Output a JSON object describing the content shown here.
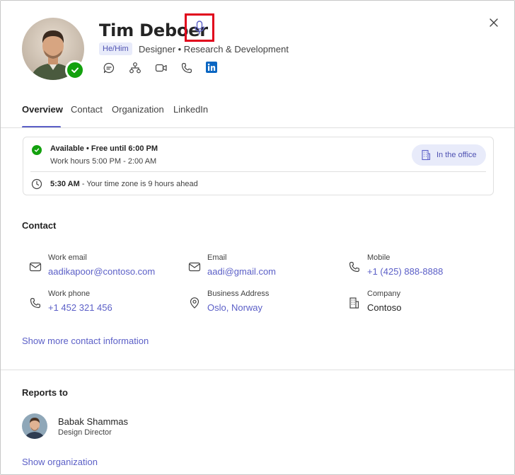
{
  "profile": {
    "name": "Tim Deboer",
    "pronouns": "He/Him",
    "subtitle": "Designer • Research & Development"
  },
  "tabs": [
    {
      "label": "Overview"
    },
    {
      "label": "Contact"
    },
    {
      "label": "Organization"
    },
    {
      "label": "LinkedIn"
    }
  ],
  "status": {
    "availability": "Available • Free until 6:00 PM",
    "work_hours": "Work hours 5:00 PM - 2:00 AM",
    "location_label": "In the office",
    "local_time": "5:30 AM",
    "timezone_note": " - Your time zone is 9 hours ahead"
  },
  "contact": {
    "title": "Contact",
    "items": [
      {
        "label": "Work email",
        "value": "aadikapoor@contoso.com",
        "icon": "mail-icon"
      },
      {
        "label": "Email",
        "value": "aadi@gmail.com",
        "icon": "mail-icon"
      },
      {
        "label": "Mobile",
        "value": "+1 (425) 888-8888",
        "icon": "phone-icon"
      },
      {
        "label": "Work phone",
        "value": "+1 452 321 456",
        "icon": "phone-icon"
      },
      {
        "label": "Business Address",
        "value": "Oslo, Norway",
        "icon": "location-icon"
      },
      {
        "label": "Company",
        "value": "Contoso",
        "icon": "building-icon"
      }
    ],
    "show_more": "Show more contact information"
  },
  "reports_to": {
    "title": "Reports to",
    "name": "Babak Shammas",
    "role": "Design Director",
    "show_org": "Show organization"
  },
  "colors": {
    "accent": "#5b5fc7",
    "presence": "#13a10e",
    "highlight_box": "#e0001b"
  }
}
